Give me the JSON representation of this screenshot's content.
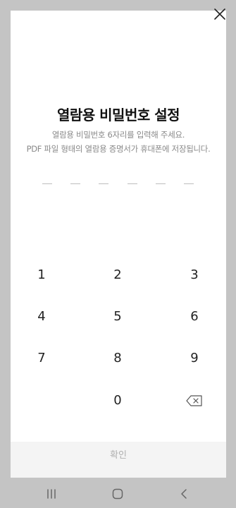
{
  "dialog": {
    "title": "열람용 비밀번호 설정",
    "description_line1": "열람용 비밀번호 6자리를 입력해 주세요.",
    "description_line2": "PDF 파일 형태의 열람용 증명서가 휴대폰에 저장됩니다.",
    "pin_length": 6,
    "close_icon": "close-icon"
  },
  "keypad": {
    "keys": [
      "1",
      "2",
      "3",
      "4",
      "5",
      "6",
      "7",
      "8",
      "9",
      "",
      "0",
      "backspace"
    ],
    "backspace_icon": "backspace-icon"
  },
  "confirm_label": "확인",
  "navbar": {
    "items": [
      "recent-apps-icon",
      "home-icon",
      "back-icon"
    ]
  }
}
